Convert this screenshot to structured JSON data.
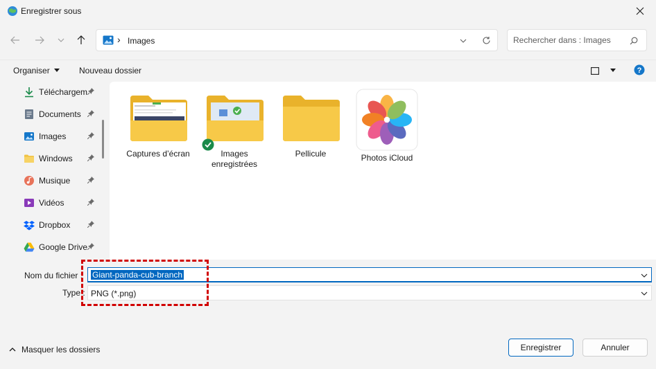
{
  "window": {
    "title": "Enregistrer sous"
  },
  "address": {
    "location": "Images",
    "separator": "›"
  },
  "search": {
    "placeholder": "Rechercher dans : Images"
  },
  "toolbar": {
    "organize_label": "Organiser",
    "new_folder_label": "Nouveau dossier"
  },
  "sidebar": {
    "items": [
      {
        "label": "Téléchargem",
        "icon": "download-icon",
        "color": "#1a8a4a"
      },
      {
        "label": "Documents",
        "icon": "document-icon",
        "color": "#6b7a8c"
      },
      {
        "label": "Images",
        "icon": "picture-icon",
        "color": "#1577c9"
      },
      {
        "label": "Windows",
        "icon": "folder-icon",
        "color": "#f0c242"
      },
      {
        "label": "Musique",
        "icon": "music-icon",
        "color": "#e8735a"
      },
      {
        "label": "Vidéos",
        "icon": "video-icon",
        "color": "#8a3ab9"
      },
      {
        "label": "Dropbox",
        "icon": "dropbox-icon",
        "color": "#0061fe"
      },
      {
        "label": "Google Drive",
        "icon": "google-drive-icon",
        "color": "#34a853"
      }
    ]
  },
  "folders": [
    {
      "label": "Captures d’écran"
    },
    {
      "label": "Images enregistrées"
    },
    {
      "label": "Pellicule"
    },
    {
      "label": "Photos iCloud"
    }
  ],
  "form": {
    "filename_label": "Nom du fichier :",
    "filename_value": "Giant-panda-cub-branch",
    "type_label": "Type :",
    "type_value": "PNG (*.png)"
  },
  "footer": {
    "hide_folders_label": "Masquer les dossiers",
    "save_label": "Enregistrer",
    "cancel_label": "Annuler"
  },
  "colors": {
    "accent": "#0067c0",
    "highlight_border": "#d10000",
    "folder": "#f7c948"
  }
}
